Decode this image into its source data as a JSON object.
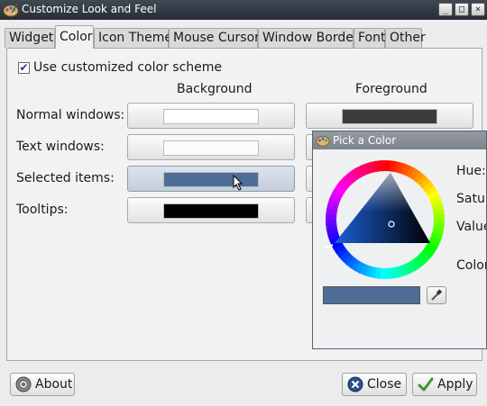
{
  "window": {
    "title": "Customize Look and Feel",
    "controls": [
      "_",
      "□",
      "×"
    ]
  },
  "tabs": [
    {
      "label": "Widget",
      "active": false
    },
    {
      "label": "Color",
      "active": true
    },
    {
      "label": "Icon Theme",
      "active": false
    },
    {
      "label": "Mouse Cursor",
      "active": false
    },
    {
      "label": "Window Border",
      "active": false
    },
    {
      "label": "Font",
      "active": false
    },
    {
      "label": "Other",
      "active": false
    }
  ],
  "color_tab": {
    "use_custom_label": "Use customized color scheme",
    "use_custom_checked": true,
    "columns": {
      "background": "Background",
      "foreground": "Foreground"
    },
    "rows": [
      {
        "label": "Normal windows:",
        "bg": "#ffffff",
        "fg": "#3c3c3c"
      },
      {
        "label": "Text windows:",
        "bg": "#fbfbfb",
        "fg": "#000000"
      },
      {
        "label": "Selected items:",
        "bg": "#4e6d96",
        "fg": "#ffffff"
      },
      {
        "label": "Tooltips:",
        "bg": "#000000",
        "fg": "#ffffff"
      }
    ]
  },
  "pick_dialog": {
    "title": "Pick a Color",
    "labels": {
      "hue": "Hue:",
      "saturation": "Satur",
      "value": "Value",
      "color_name": "Color"
    },
    "current_color": "#4e6d96"
  },
  "buttons": {
    "about": "About",
    "close": "Close",
    "apply": "Apply"
  }
}
